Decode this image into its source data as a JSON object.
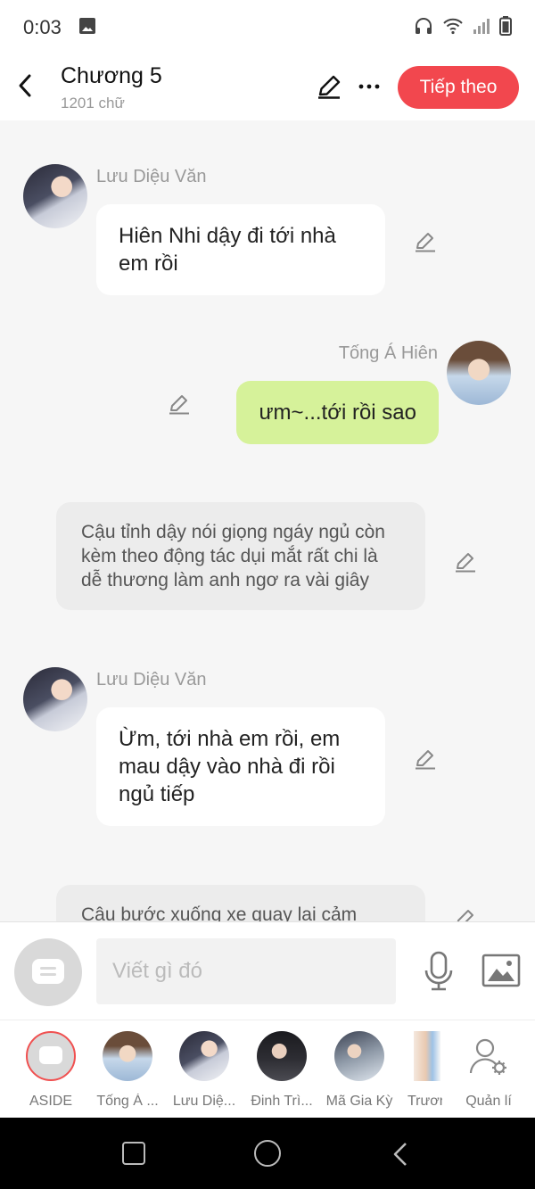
{
  "status_bar": {
    "time": "0:03"
  },
  "header": {
    "title": "Chương 5",
    "word_count": "1201 chữ",
    "next_label": "Tiếp theo",
    "accent": "#f2474e"
  },
  "messages": [
    {
      "type": "left",
      "sender": "Lưu Diệu Văn",
      "text": "Hiên Nhi dậy đi tới nhà em rồi"
    },
    {
      "type": "right",
      "sender": "Tống Á Hiên",
      "text": "ưm~...tới rồi sao"
    },
    {
      "type": "narration",
      "text": "Cậu tỉnh dậy nói giọng ngáy ngủ còn kèm theo động tác dụi mắt rất chi là dễ thương làm anh ngơ ra vài giây"
    },
    {
      "type": "left",
      "sender": "Lưu Diệu Văn",
      "text": "Ừm, tới nhà em rồi, em mau dậy vào nhà đi rồi ngủ tiếp"
    },
    {
      "type": "narration",
      "text": "Cậu bước xuống xe quay lại cảm"
    }
  ],
  "input": {
    "placeholder": "Viết gì đó"
  },
  "characters": [
    {
      "label": "ASIDE"
    },
    {
      "label": "Tống Á ..."
    },
    {
      "label": "Lưu Diệ..."
    },
    {
      "label": "Đinh Trì..."
    },
    {
      "label": "Mã Gia Kỳ"
    },
    {
      "label": "Trươn"
    },
    {
      "label": "Quản lí"
    }
  ],
  "colors": {
    "green_bubble": "#d6f29a",
    "narration_bubble": "#ececec"
  }
}
